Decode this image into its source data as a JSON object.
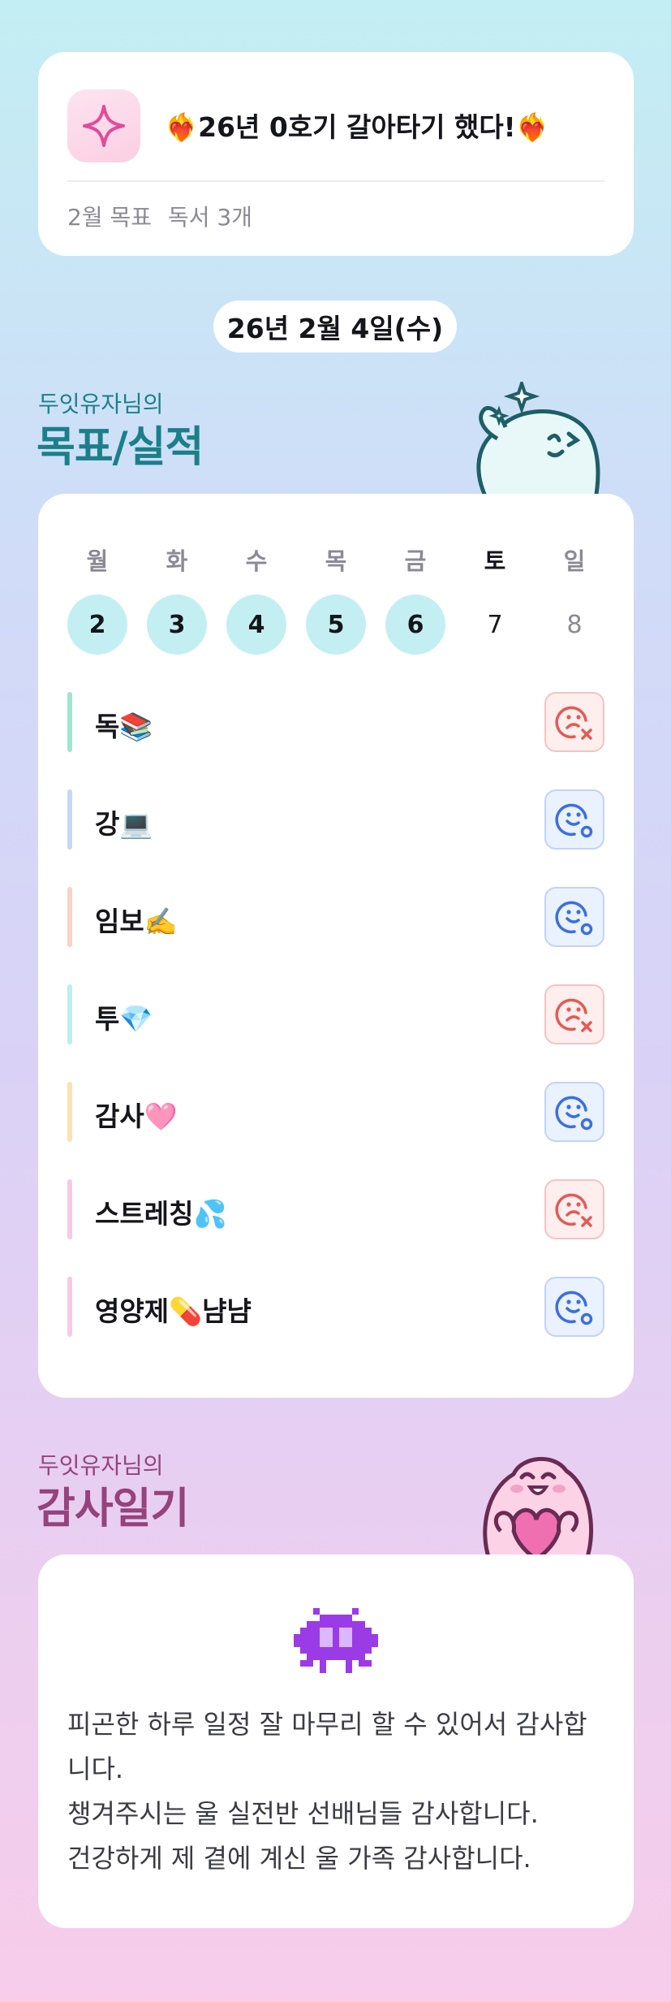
{
  "goal_card": {
    "title": "❤️‍🔥26년 0호기 갈아타기 했다!❤️‍🔥",
    "month_label": "2월 목표",
    "month_goal": "독서 3개"
  },
  "date_pill": "26년 2월 4일(수)",
  "goals_section": {
    "small_title": "두잇유자님의",
    "big_title": "목표/실적"
  },
  "week": {
    "days": [
      {
        "label": "월",
        "num": "2",
        "state": "done"
      },
      {
        "label": "화",
        "num": "3",
        "state": "done"
      },
      {
        "label": "수",
        "num": "4",
        "state": "done"
      },
      {
        "label": "목",
        "num": "5",
        "state": "done"
      },
      {
        "label": "금",
        "num": "6",
        "state": "done"
      },
      {
        "label": "토",
        "num": "7",
        "state": "today"
      },
      {
        "label": "일",
        "num": "8",
        "state": "future"
      }
    ]
  },
  "goals": [
    {
      "label": "독📚",
      "status": "fail",
      "bar_color": "#9ee6cf"
    },
    {
      "label": "강💻",
      "status": "ok",
      "bar_color": "#c9d7f5"
    },
    {
      "label": "임보✍️",
      "status": "ok",
      "bar_color": "#f8d3c8"
    },
    {
      "label": "투💎",
      "status": "fail",
      "bar_color": "#bdeef0"
    },
    {
      "label": "감사🩷",
      "status": "ok",
      "bar_color": "#fbe2b4"
    },
    {
      "label": "스트레칭💦",
      "status": "fail",
      "bar_color": "#f7c9e4"
    },
    {
      "label": "영양제💊냠냠",
      "status": "ok",
      "bar_color": "#f7c9e4"
    }
  ],
  "diary_section": {
    "small_title": "두잇유자님의",
    "big_title": "감사일기"
  },
  "diary": {
    "lines": [
      "피곤한 하루 일정 잘 마무리 할 수 있어서 감사합니다.",
      "챙겨주시는 울 실전반 선배님들 감사합니다.",
      "건강하게 제 곁에 계신 울 가족 감사합니다."
    ]
  },
  "colors": {
    "teal_title": "#1b7f8a",
    "plum_title": "#96427c",
    "fail_red": "#e35a55",
    "ok_blue": "#3b6fe0",
    "done_circle": "#c3eff3"
  }
}
